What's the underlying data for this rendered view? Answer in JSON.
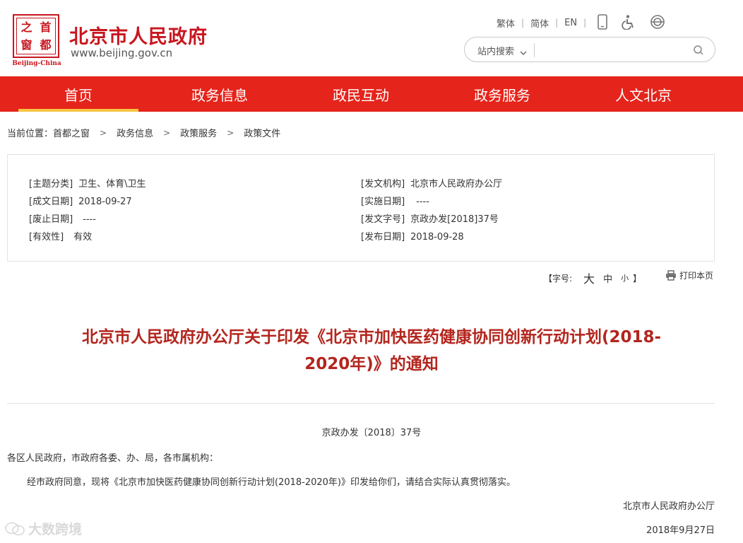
{
  "header": {
    "seal_chars": [
      "之",
      "首",
      "窗",
      "都"
    ],
    "seal_caption": "Beijing-China",
    "site_title": "北京市人民政府",
    "site_url": "www.beijing.gov.cn",
    "languages": [
      "繁体",
      "简体",
      "EN"
    ],
    "icons": [
      "mobile-icon",
      "accessibility-icon",
      "elder-mode-icon"
    ],
    "search": {
      "scope_label": "站内搜索",
      "placeholder": "",
      "value": ""
    }
  },
  "nav": {
    "items": [
      {
        "label": "首页",
        "active": true
      },
      {
        "label": "政务信息",
        "active": false
      },
      {
        "label": "政民互动",
        "active": false
      },
      {
        "label": "政务服务",
        "active": false
      },
      {
        "label": "人文北京",
        "active": false
      }
    ]
  },
  "breadcrumb": {
    "prefix": "当前位置：",
    "items": [
      "首都之窗",
      "政务信息",
      "政策服务",
      "政策文件"
    ]
  },
  "meta": {
    "left": [
      {
        "key": "[主题分类]",
        "value": "卫生、体育\\卫生"
      },
      {
        "key": "[成文日期]",
        "value": "2018-09-27"
      },
      {
        "key": "[废止日期]",
        "value": "----"
      },
      {
        "key": "[有效性]",
        "value": "有效"
      }
    ],
    "right": [
      {
        "key": "[发文机构]",
        "value": "北京市人民政府办公厅"
      },
      {
        "key": "[实施日期]",
        "value": "----"
      },
      {
        "key": "[发文字号]",
        "value": "京政办发[2018]37号"
      },
      {
        "key": "[发布日期]",
        "value": "2018-09-28"
      }
    ]
  },
  "tools": {
    "font_label": "【字号:",
    "size_large": "大",
    "size_medium": "中",
    "size_small": "小",
    "font_end": "】",
    "print_label": "打印本页"
  },
  "document": {
    "title_line1": "北京市人民政府办公厅关于印发《北京市加快医药健康协同创新行动计划(2018-",
    "title_line2": "2020年)》的通知",
    "doc_number": "京政办发〔2018〕37号",
    "salutation": "各区人民政府，市政府各委、办、局，各市属机构：",
    "body": "经市政府同意，现将《北京市加快医药健康协同创新行动计划(2018-2020年)》印发给你们，请结合实际认真贯彻落实。",
    "issuer": "北京市人民政府办公厅",
    "date": "2018年9月27日"
  },
  "watermark": {
    "text": "大数跨境"
  },
  "colors": {
    "brand_red": "#c8161e",
    "nav_red": "#e5241b",
    "active_underline": "#f6c544",
    "title_red": "#b3261e"
  }
}
